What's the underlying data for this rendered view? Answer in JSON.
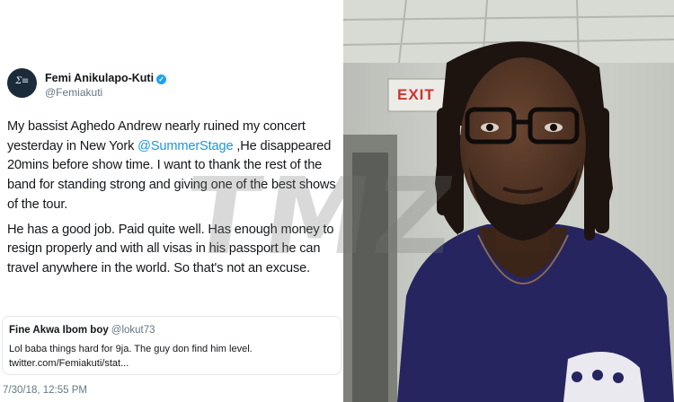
{
  "tweet": {
    "avatar_text": "Ʃ≡",
    "display_name": "Femi Anikulapo-Kuti",
    "handle": "@Femiakuti",
    "body": {
      "p1_before": "My bassist Aghedo Andrew nearly ruined my concert yesterday in New York ",
      "p1_mention": "@SummerStage",
      "p1_after": " ,He disappeared 20mins before show time. I want to thank the rest of the band for standing strong and giving one of the best shows of the tour.",
      "p2": "He has a good job. Paid quite well. Has enough money to resign properly and with all visas in his passport he can travel anywhere in the world. So that's not an excuse."
    },
    "quote": {
      "name": "Fine Akwa Ibom boy",
      "handle": "@lokut73",
      "line1": "Lol baba things hard for 9ja. The guy don find him level.",
      "line2": "twitter.com/Femiakuti/stat..."
    },
    "timestamp": "7/30/18, 12:55 PM"
  },
  "photo": {
    "exit_sign": "EXIT",
    "watermark": "TMZ"
  },
  "colors": {
    "mention_blue": "#1b95e0",
    "verified_blue": "#1da1f2",
    "muted_gray": "#657786",
    "exit_red": "#c8372d",
    "shirt_navy": "#262560"
  }
}
